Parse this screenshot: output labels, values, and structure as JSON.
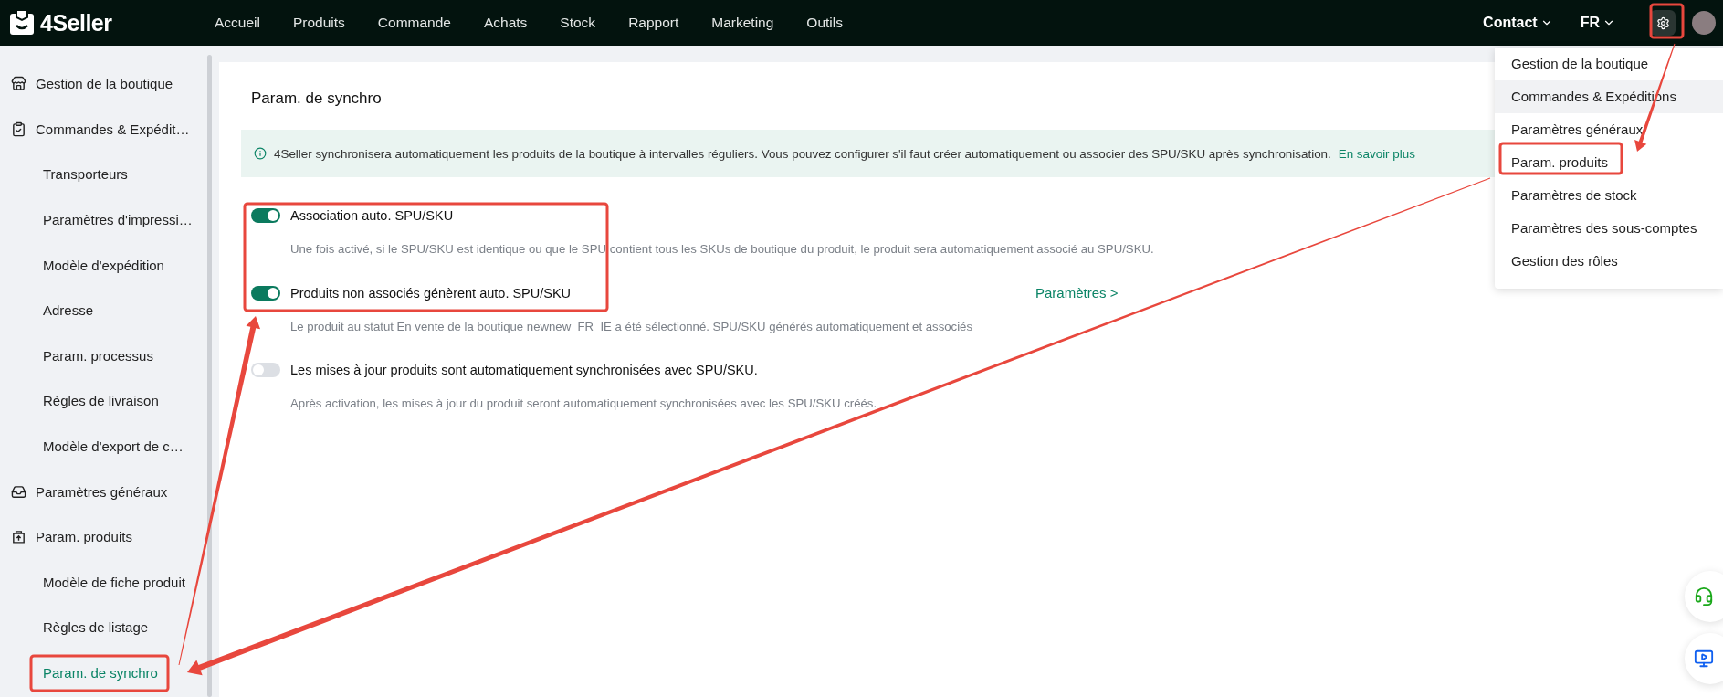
{
  "topbar": {
    "logo": "4Seller",
    "nav": [
      {
        "label": "Accueil"
      },
      {
        "label": "Produits"
      },
      {
        "label": "Commande"
      },
      {
        "label": "Achats"
      },
      {
        "label": "Stock"
      },
      {
        "label": "Rapport"
      },
      {
        "label": "Marketing"
      },
      {
        "label": "Outils"
      }
    ],
    "contact": "Contact",
    "language": "FR"
  },
  "settings_menu": {
    "items": [
      {
        "label": "Gestion de la boutique",
        "hovered": false
      },
      {
        "label": "Commandes & Expéditions",
        "hovered": true
      },
      {
        "label": "Paramètres généraux",
        "hovered": false
      },
      {
        "label": "Param. produits",
        "hovered": false
      },
      {
        "label": "Paramètres de stock",
        "hovered": false
      },
      {
        "label": "Paramètres des sous-comptes",
        "hovered": false
      },
      {
        "label": "Gestion des rôles",
        "hovered": false
      }
    ]
  },
  "sidebar": {
    "items": [
      {
        "label": "Gestion de la boutique",
        "kind": "store"
      },
      {
        "label": "Commandes & Expédit…",
        "kind": "clipboard",
        "children": [
          {
            "label": "Transporteurs",
            "selected": false
          },
          {
            "label": "Paramètres d'impressi…",
            "selected": false
          },
          {
            "label": "Modèle d'expédition",
            "selected": false
          },
          {
            "label": "Adresse",
            "selected": false
          },
          {
            "label": "Param. processus",
            "selected": false
          },
          {
            "label": "Règles de livraison",
            "selected": false
          },
          {
            "label": "Modèle d'export de c…",
            "selected": false
          }
        ]
      },
      {
        "label": "Paramètres généraux",
        "kind": "tray"
      },
      {
        "label": "Param. produits",
        "kind": "bag",
        "children": [
          {
            "label": "Modèle de fiche produit",
            "selected": false
          },
          {
            "label": "Règles de listage",
            "selected": false
          },
          {
            "label": "Param. de synchro",
            "selected": true
          }
        ]
      }
    ]
  },
  "page": {
    "title": "Param. de synchro",
    "notice": "4Seller synchronisera automatiquement les produits de la boutique à intervalles réguliers. Vous pouvez configurer s'il faut créer automatiquement ou associer des SPU/SKU après synchronisation.",
    "notice_link": "En savoir plus",
    "settings": [
      {
        "label": "Association auto. SPU/SKU",
        "on": true,
        "description": "Une fois activé, si le SPU/SKU est identique ou que le SPU contient tous les SKUs de boutique du produit, le produit sera automatiquement associé au SPU/SKU."
      },
      {
        "label": "Produits non associés génèrent auto. SPU/SKU",
        "on": true,
        "link": "Paramètres >",
        "description": "Le produit au statut En vente de la boutique newnew_FR_IE a été sélectionné. SPU/SKU générés automatiquement et associés"
      },
      {
        "label": "Les mises à jour produits sont automatiquement synchronisées avec SPU/SKU.",
        "on": false,
        "description": "Après activation, les mises à jour du produit seront automatiquement synchronisées avec les SPU/SKU créés."
      }
    ]
  }
}
